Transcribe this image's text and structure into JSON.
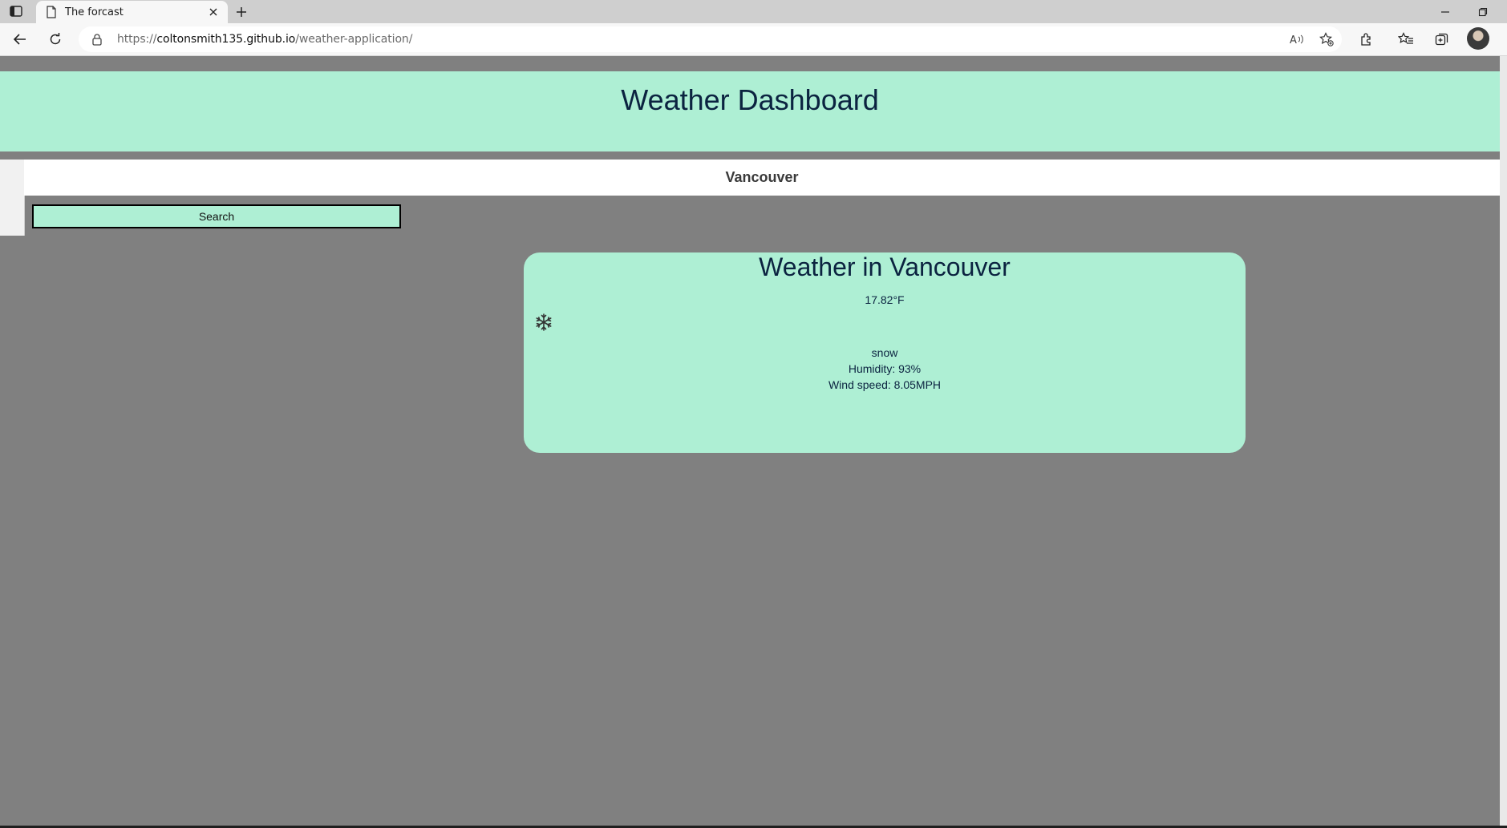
{
  "browser": {
    "tab_title": "The forcast",
    "url_scheme": "https://",
    "url_host": "coltonsmith135.github.io",
    "url_path": "/weather-application/"
  },
  "page": {
    "header_title": "Weather Dashboard",
    "city_input_value": "Vancouver",
    "search_button_label": "Search",
    "colors": {
      "background": "#808080",
      "accent": "#aeefd4",
      "heading_text": "#0b2340"
    }
  },
  "weather": {
    "title": "Weather in Vancouver",
    "temperature": "17.82°F",
    "icon": "snowflake-icon",
    "description": "snow",
    "humidity": "Humidity: 93%",
    "wind_speed": "Wind speed: 8.05MPH"
  }
}
